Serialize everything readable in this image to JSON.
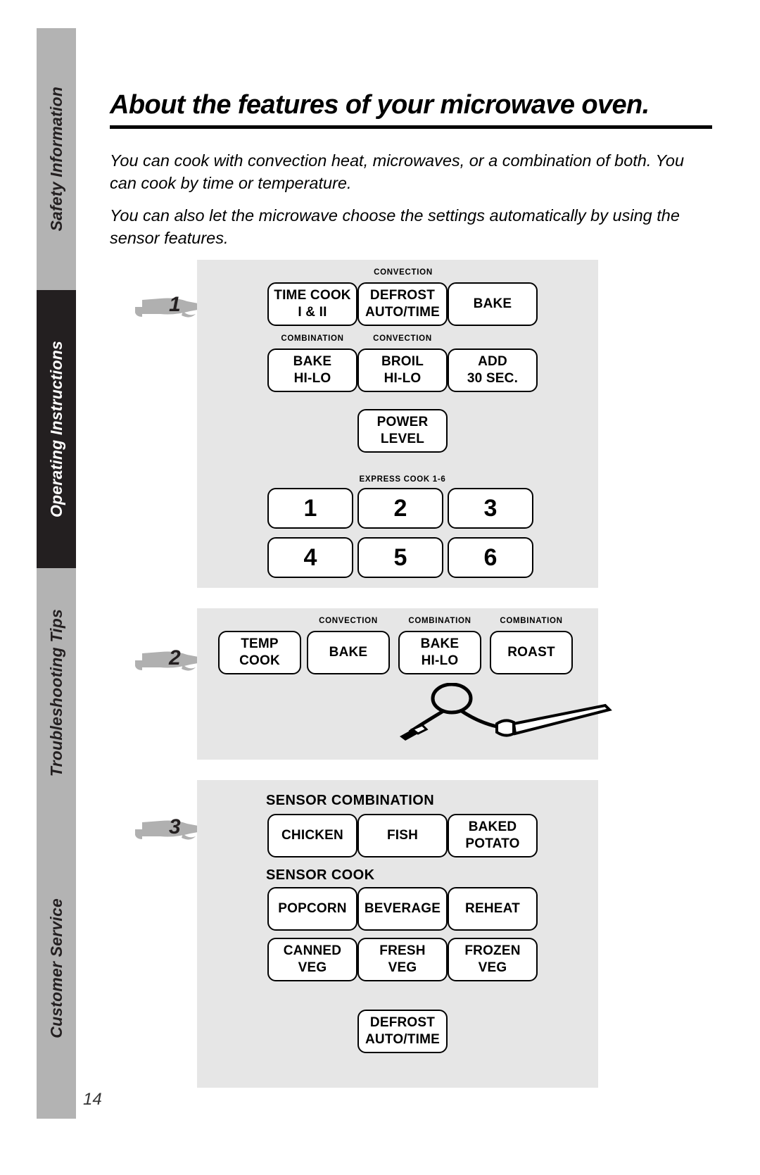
{
  "page": {
    "title": "About the features of your microwave oven.",
    "number": "14",
    "intro": [
      "You can cook with convection heat, microwaves, or a combination of both. You can cook by time or temperature.",
      "You can also let the microwave choose the settings automatically by using the sensor features."
    ]
  },
  "sidebar": {
    "tabs": [
      {
        "label": "Safety Information",
        "active": false
      },
      {
        "label": "Operating Instructions",
        "active": true
      },
      {
        "label": "Troubleshooting Tips",
        "active": false
      },
      {
        "label": "Customer Service",
        "active": false
      }
    ]
  },
  "callouts": [
    {
      "number": "1"
    },
    {
      "number": "2"
    },
    {
      "number": "3"
    }
  ],
  "panel1": {
    "keys": [
      {
        "caption": "",
        "lines": [
          "TIME COOK",
          "I & II"
        ]
      },
      {
        "caption": "",
        "lines": [
          "DEFROST",
          "AUTO/TIME"
        ]
      },
      {
        "caption": "CONVECTION",
        "lines": [
          "BAKE"
        ]
      },
      {
        "caption": "COMBINATION",
        "lines": [
          "BAKE",
          "HI-LO"
        ]
      },
      {
        "caption": "CONVECTION",
        "lines": [
          "BROIL",
          "HI-LO"
        ]
      },
      {
        "caption": "",
        "lines": [
          "ADD",
          "30 SEC."
        ]
      },
      {
        "caption": "",
        "lines": [
          "POWER",
          "LEVEL"
        ]
      }
    ],
    "express_caption": "EXPRESS COOK  1-6",
    "numbers": [
      "1",
      "2",
      "3",
      "4",
      "5",
      "6"
    ]
  },
  "panel2": {
    "keys": [
      {
        "caption": "",
        "lines": [
          "TEMP",
          "COOK"
        ]
      },
      {
        "caption": "CONVECTION",
        "lines": [
          "BAKE"
        ]
      },
      {
        "caption": "COMBINATION",
        "lines": [
          "BAKE",
          "HI-LO"
        ]
      },
      {
        "caption": "COMBINATION",
        "lines": [
          "ROAST"
        ]
      }
    ],
    "illustration": "temperature-probe"
  },
  "panel3": {
    "sections": [
      {
        "heading": "SENSOR COMBINATION",
        "keys": [
          {
            "lines": [
              "CHICKEN"
            ]
          },
          {
            "lines": [
              "FISH"
            ]
          },
          {
            "lines": [
              "BAKED",
              "POTATO"
            ]
          }
        ]
      },
      {
        "heading": "SENSOR COOK",
        "keys": [
          {
            "lines": [
              "POPCORN"
            ]
          },
          {
            "lines": [
              "BEVERAGE"
            ]
          },
          {
            "lines": [
              "REHEAT"
            ]
          },
          {
            "lines": [
              "CANNED",
              "VEG"
            ]
          },
          {
            "lines": [
              "FRESH",
              "VEG"
            ]
          },
          {
            "lines": [
              "FROZEN",
              "VEG"
            ]
          }
        ]
      }
    ],
    "defrost_key": {
      "lines": [
        "DEFROST",
        "AUTO/TIME"
      ]
    }
  },
  "colors": {
    "panel_background": "#e6e6e6",
    "tab_inactive": "#b3b3b3",
    "tab_active": "#231f20",
    "key_fill": "#ffffff",
    "ink": "#000000"
  }
}
